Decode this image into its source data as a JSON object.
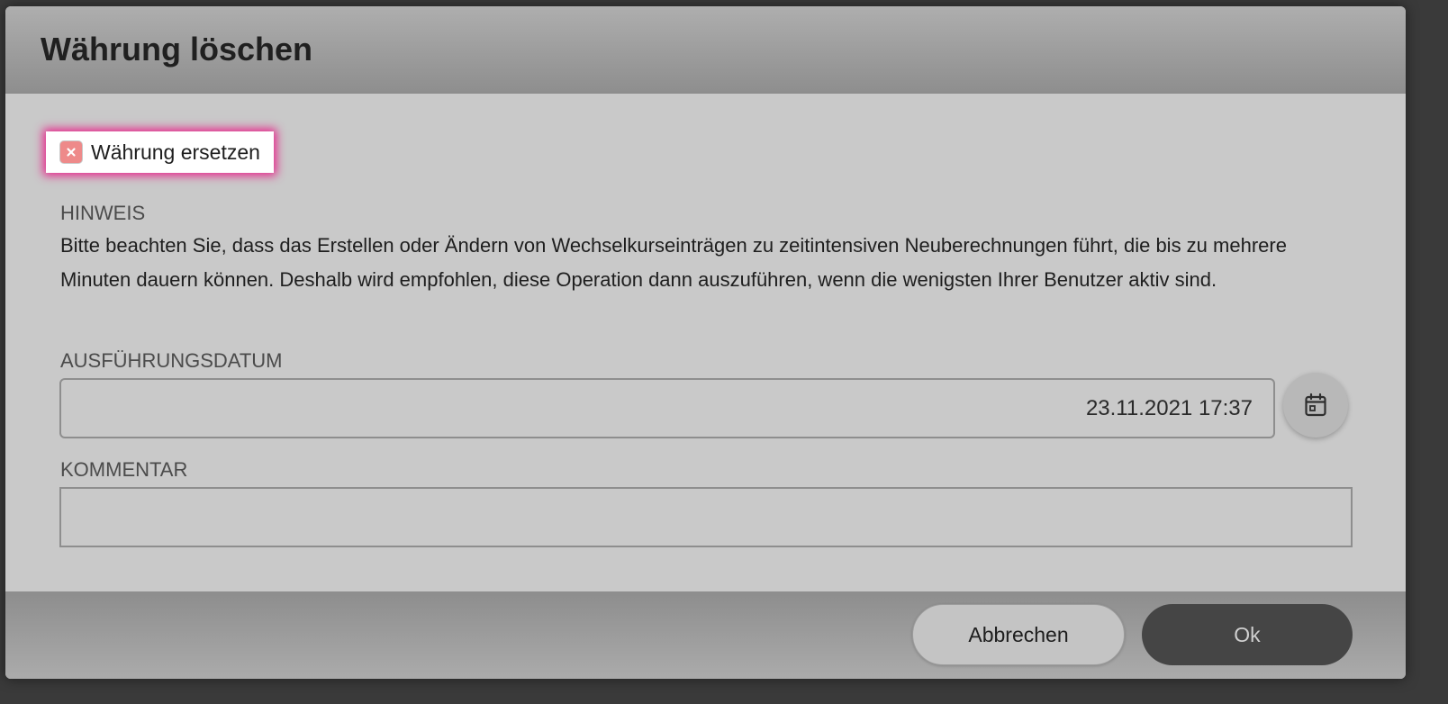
{
  "dialog": {
    "title": "Währung löschen"
  },
  "replace_toggle": {
    "label": "Währung ersetzen",
    "checked": false,
    "accent_color": "#e8228a",
    "box_color": "#ee8a8a"
  },
  "notice": {
    "heading": "HINWEIS",
    "text": "Bitte beachten Sie, dass das Erstellen oder Ändern von Wechselkurseinträgen zu zeitintensiven Neuberechnungen führt, die bis zu mehrere Minuten dauern können. Deshalb wird empfohlen, diese Operation dann auszuführen, wenn die wenigsten Ihrer Benutzer aktiv sind."
  },
  "execution_date": {
    "label": "AUSFÜHRUNGSDATUM",
    "value": "23.11.2021 17:37",
    "button_icon": "calendar-icon"
  },
  "comment": {
    "label": "KOMMENTAR",
    "value": ""
  },
  "footer": {
    "cancel_label": "Abbrechen",
    "ok_label": "Ok"
  }
}
